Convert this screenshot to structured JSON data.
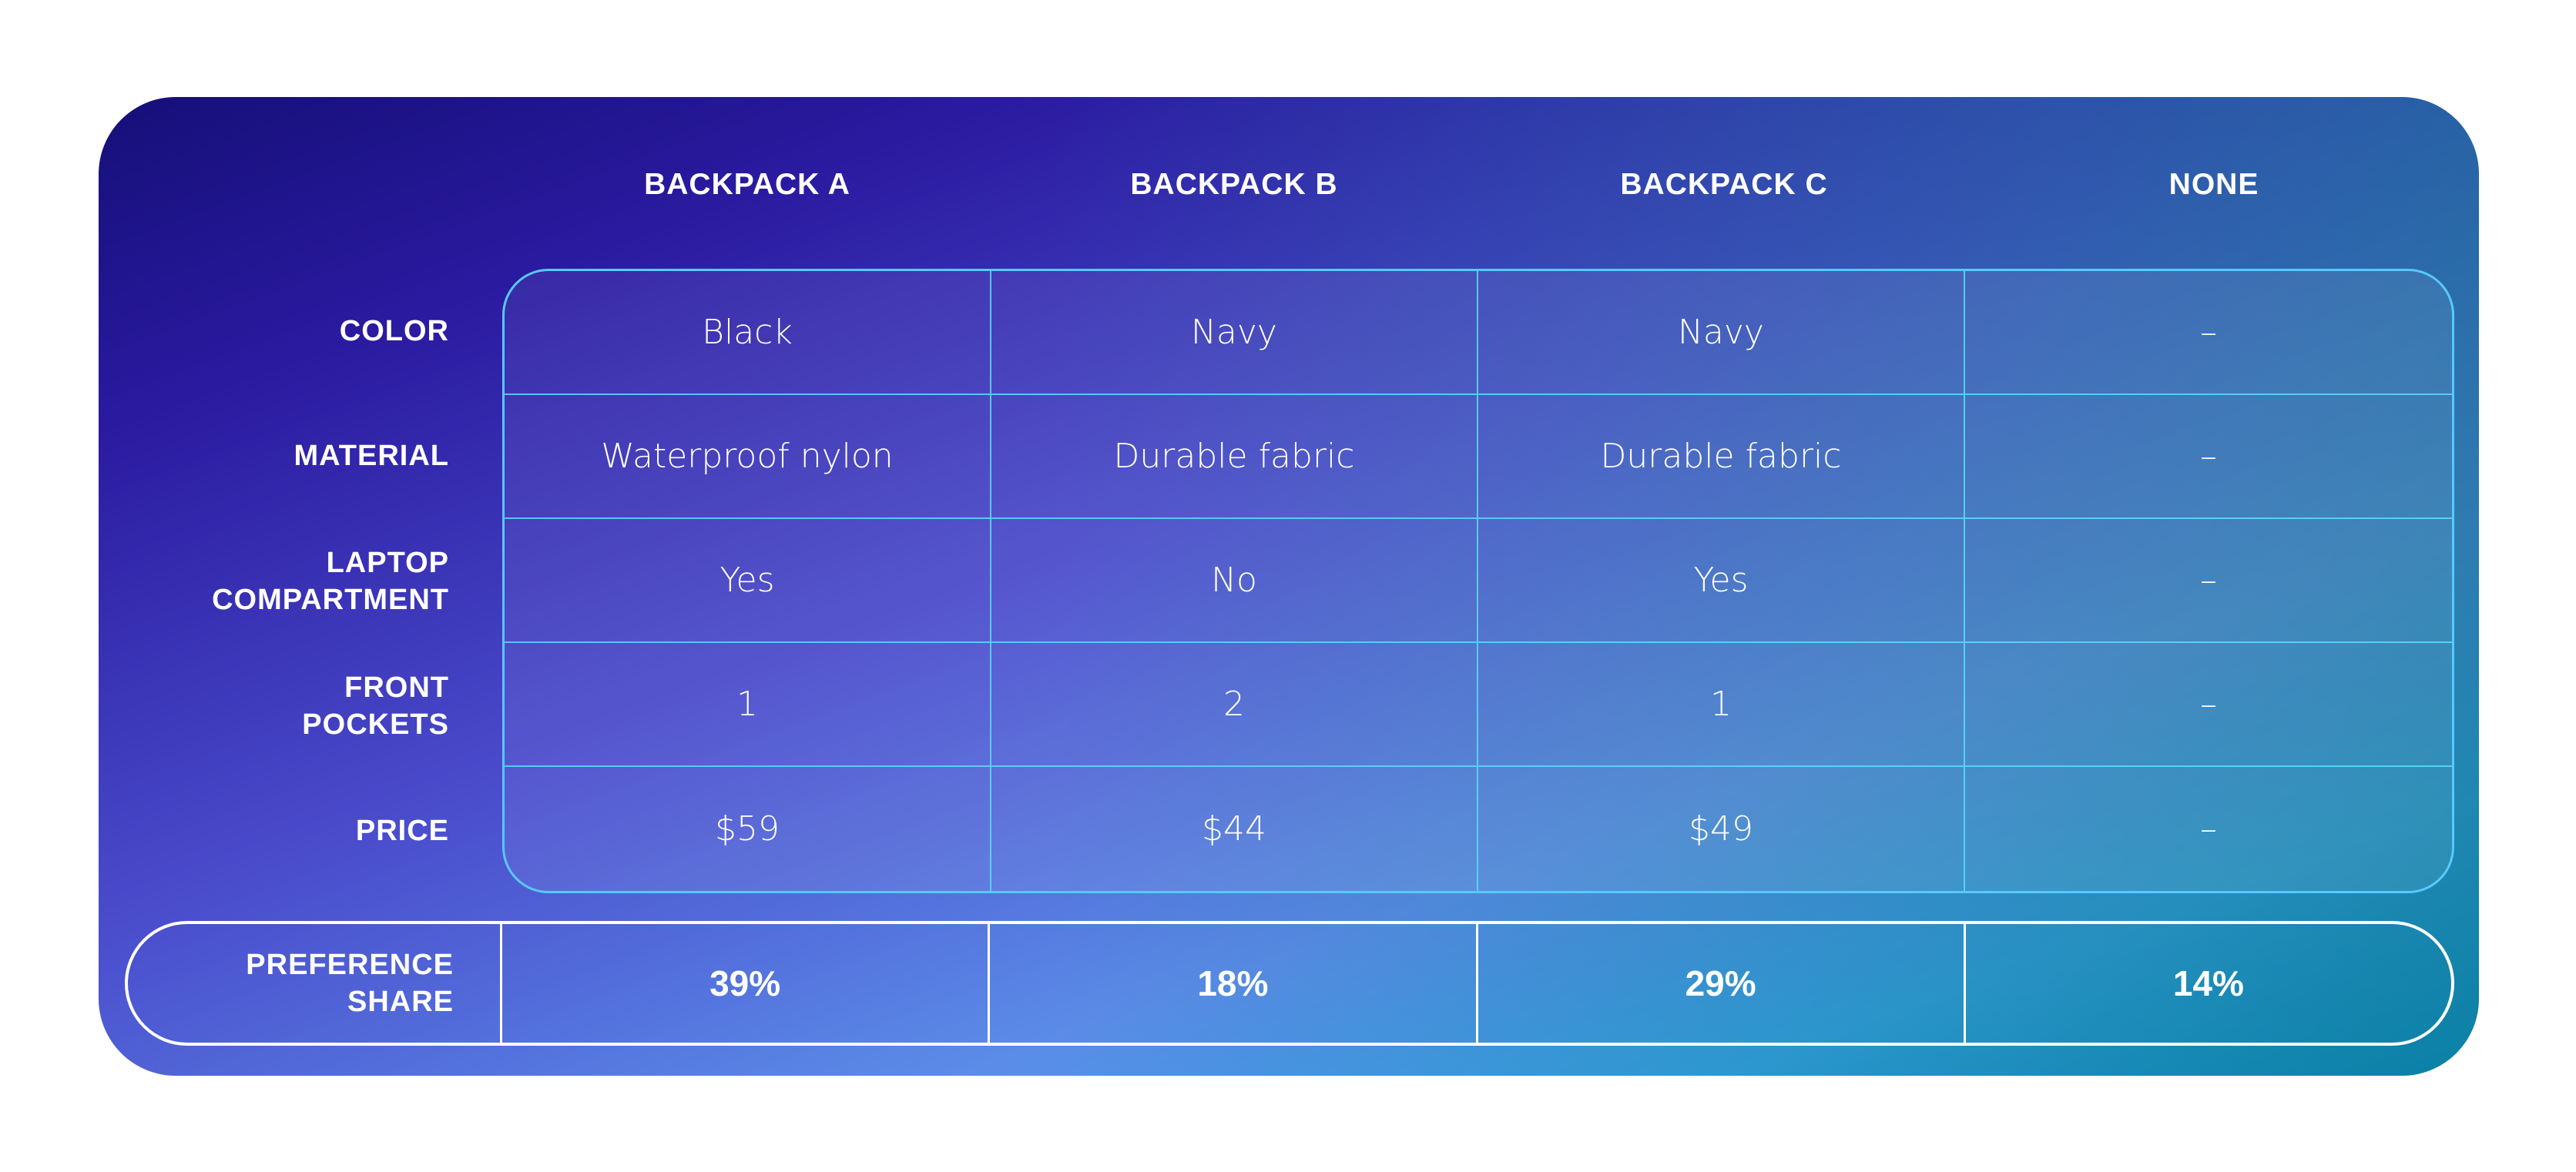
{
  "columns": [
    "BACKPACK A",
    "BACKPACK B",
    "BACKPACK C",
    "NONE"
  ],
  "rows": [
    {
      "label": "COLOR",
      "values": [
        "Black",
        "Navy",
        "Navy",
        "–"
      ]
    },
    {
      "label": "MATERIAL",
      "values": [
        "Waterproof nylon",
        "Durable fabric",
        "Durable fabric",
        "–"
      ]
    },
    {
      "label": "LAPTOP\nCOMPARTMENT",
      "values": [
        "Yes",
        "No",
        "Yes",
        "–"
      ]
    },
    {
      "label": "FRONT\nPOCKETS",
      "values": [
        "1",
        "2",
        "1",
        "–"
      ]
    },
    {
      "label": "PRICE",
      "values": [
        "$59",
        "$44",
        "$49",
        "–"
      ]
    }
  ],
  "preference": {
    "label": "PREFERENCE\nSHARE",
    "values": [
      "39%",
      "18%",
      "29%",
      "14%"
    ]
  },
  "colors": {
    "grid_line": "#57c9ff",
    "pref_border": "#ffffff",
    "text": "#ffffff"
  }
}
